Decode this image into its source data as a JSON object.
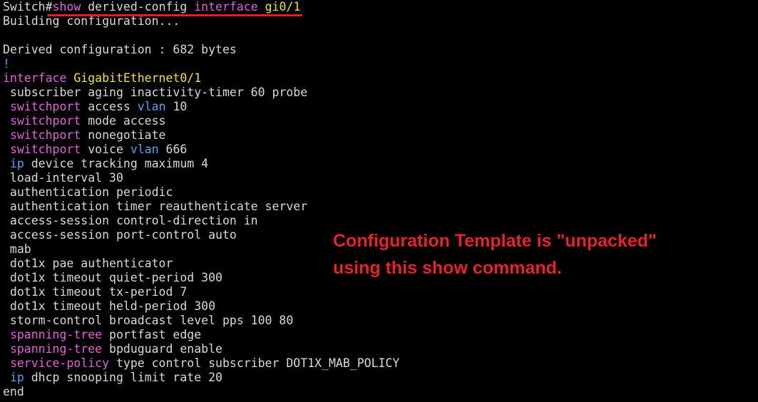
{
  "colors": {
    "background": "#000000",
    "default_text": "#d9d9d9",
    "keyword_magenta": "#e75fe0",
    "keyword_cyan": "#5a9ff2",
    "keyword_yellow": "#f0e33a",
    "highlight_red": "#e81c23"
  },
  "terminal": {
    "lines": [
      {
        "segments": [
          {
            "text": "Switch#",
            "color": "white"
          },
          {
            "text": "show",
            "color": "magenta"
          },
          {
            "text": " derived-config ",
            "color": "white"
          },
          {
            "text": "interface",
            "color": "magenta"
          },
          {
            "text": " gi0/1",
            "color": "yellow"
          }
        ]
      },
      {
        "segments": [
          {
            "text": "Building configuration...",
            "color": "white"
          }
        ]
      },
      {
        "segments": []
      },
      {
        "segments": [
          {
            "text": "Derived configuration : 682 bytes",
            "color": "white"
          }
        ]
      },
      {
        "segments": [
          {
            "text": "!",
            "color": "cyan"
          }
        ]
      },
      {
        "segments": [
          {
            "text": "interface",
            "color": "magenta"
          },
          {
            "text": " GigabitEthernet0/1",
            "color": "yellow"
          }
        ]
      },
      {
        "segments": [
          {
            "text": " subscriber aging inactivity-timer 60 probe",
            "color": "white"
          }
        ]
      },
      {
        "segments": [
          {
            "text": " ",
            "color": "white"
          },
          {
            "text": "switchport",
            "color": "magenta"
          },
          {
            "text": " access ",
            "color": "white"
          },
          {
            "text": "vlan",
            "color": "cyan"
          },
          {
            "text": " 10",
            "color": "white"
          }
        ]
      },
      {
        "segments": [
          {
            "text": " ",
            "color": "white"
          },
          {
            "text": "switchport",
            "color": "magenta"
          },
          {
            "text": " mode access",
            "color": "white"
          }
        ]
      },
      {
        "segments": [
          {
            "text": " ",
            "color": "white"
          },
          {
            "text": "switchport",
            "color": "magenta"
          },
          {
            "text": " nonegotiate",
            "color": "white"
          }
        ]
      },
      {
        "segments": [
          {
            "text": " ",
            "color": "white"
          },
          {
            "text": "switchport",
            "color": "magenta"
          },
          {
            "text": " voice ",
            "color": "white"
          },
          {
            "text": "vlan",
            "color": "cyan"
          },
          {
            "text": " 666",
            "color": "white"
          }
        ]
      },
      {
        "segments": [
          {
            "text": " ",
            "color": "white"
          },
          {
            "text": "ip",
            "color": "cyan"
          },
          {
            "text": " device tracking maximum 4",
            "color": "white"
          }
        ]
      },
      {
        "segments": [
          {
            "text": " load-interval 30",
            "color": "white"
          }
        ]
      },
      {
        "segments": [
          {
            "text": " authentication periodic",
            "color": "white"
          }
        ]
      },
      {
        "segments": [
          {
            "text": " authentication timer reauthenticate server",
            "color": "white"
          }
        ]
      },
      {
        "segments": [
          {
            "text": " access-session control-direction in",
            "color": "white"
          }
        ]
      },
      {
        "segments": [
          {
            "text": " access-session port-control auto",
            "color": "white"
          }
        ]
      },
      {
        "segments": [
          {
            "text": " mab",
            "color": "white"
          }
        ]
      },
      {
        "segments": [
          {
            "text": " dot1x pae authenticator",
            "color": "white"
          }
        ]
      },
      {
        "segments": [
          {
            "text": " dot1x timeout quiet-period 300",
            "color": "white"
          }
        ]
      },
      {
        "segments": [
          {
            "text": " dot1x timeout tx-period 7",
            "color": "white"
          }
        ]
      },
      {
        "segments": [
          {
            "text": " dot1x timeout held-period 300",
            "color": "white"
          }
        ]
      },
      {
        "segments": [
          {
            "text": " storm-control broadcast level pps 100 80",
            "color": "white"
          }
        ]
      },
      {
        "segments": [
          {
            "text": " ",
            "color": "white"
          },
          {
            "text": "spanning-tree",
            "color": "magenta"
          },
          {
            "text": " portfast edge",
            "color": "white"
          }
        ]
      },
      {
        "segments": [
          {
            "text": " ",
            "color": "white"
          },
          {
            "text": "spanning-tree",
            "color": "magenta"
          },
          {
            "text": " bpduguard enable",
            "color": "white"
          }
        ]
      },
      {
        "segments": [
          {
            "text": " ",
            "color": "white"
          },
          {
            "text": "service-policy",
            "color": "magenta"
          },
          {
            "text": " type control subscriber DOT1X_MAB_POLICY",
            "color": "white"
          }
        ]
      },
      {
        "segments": [
          {
            "text": " ",
            "color": "white"
          },
          {
            "text": "ip",
            "color": "cyan"
          },
          {
            "text": " dhcp snooping limit rate 20",
            "color": "white"
          }
        ]
      },
      {
        "segments": [
          {
            "text": "end",
            "color": "white"
          }
        ]
      }
    ]
  },
  "annotation": {
    "line1": "Configuration Template is \"unpacked\"",
    "line2": "using this show command."
  }
}
